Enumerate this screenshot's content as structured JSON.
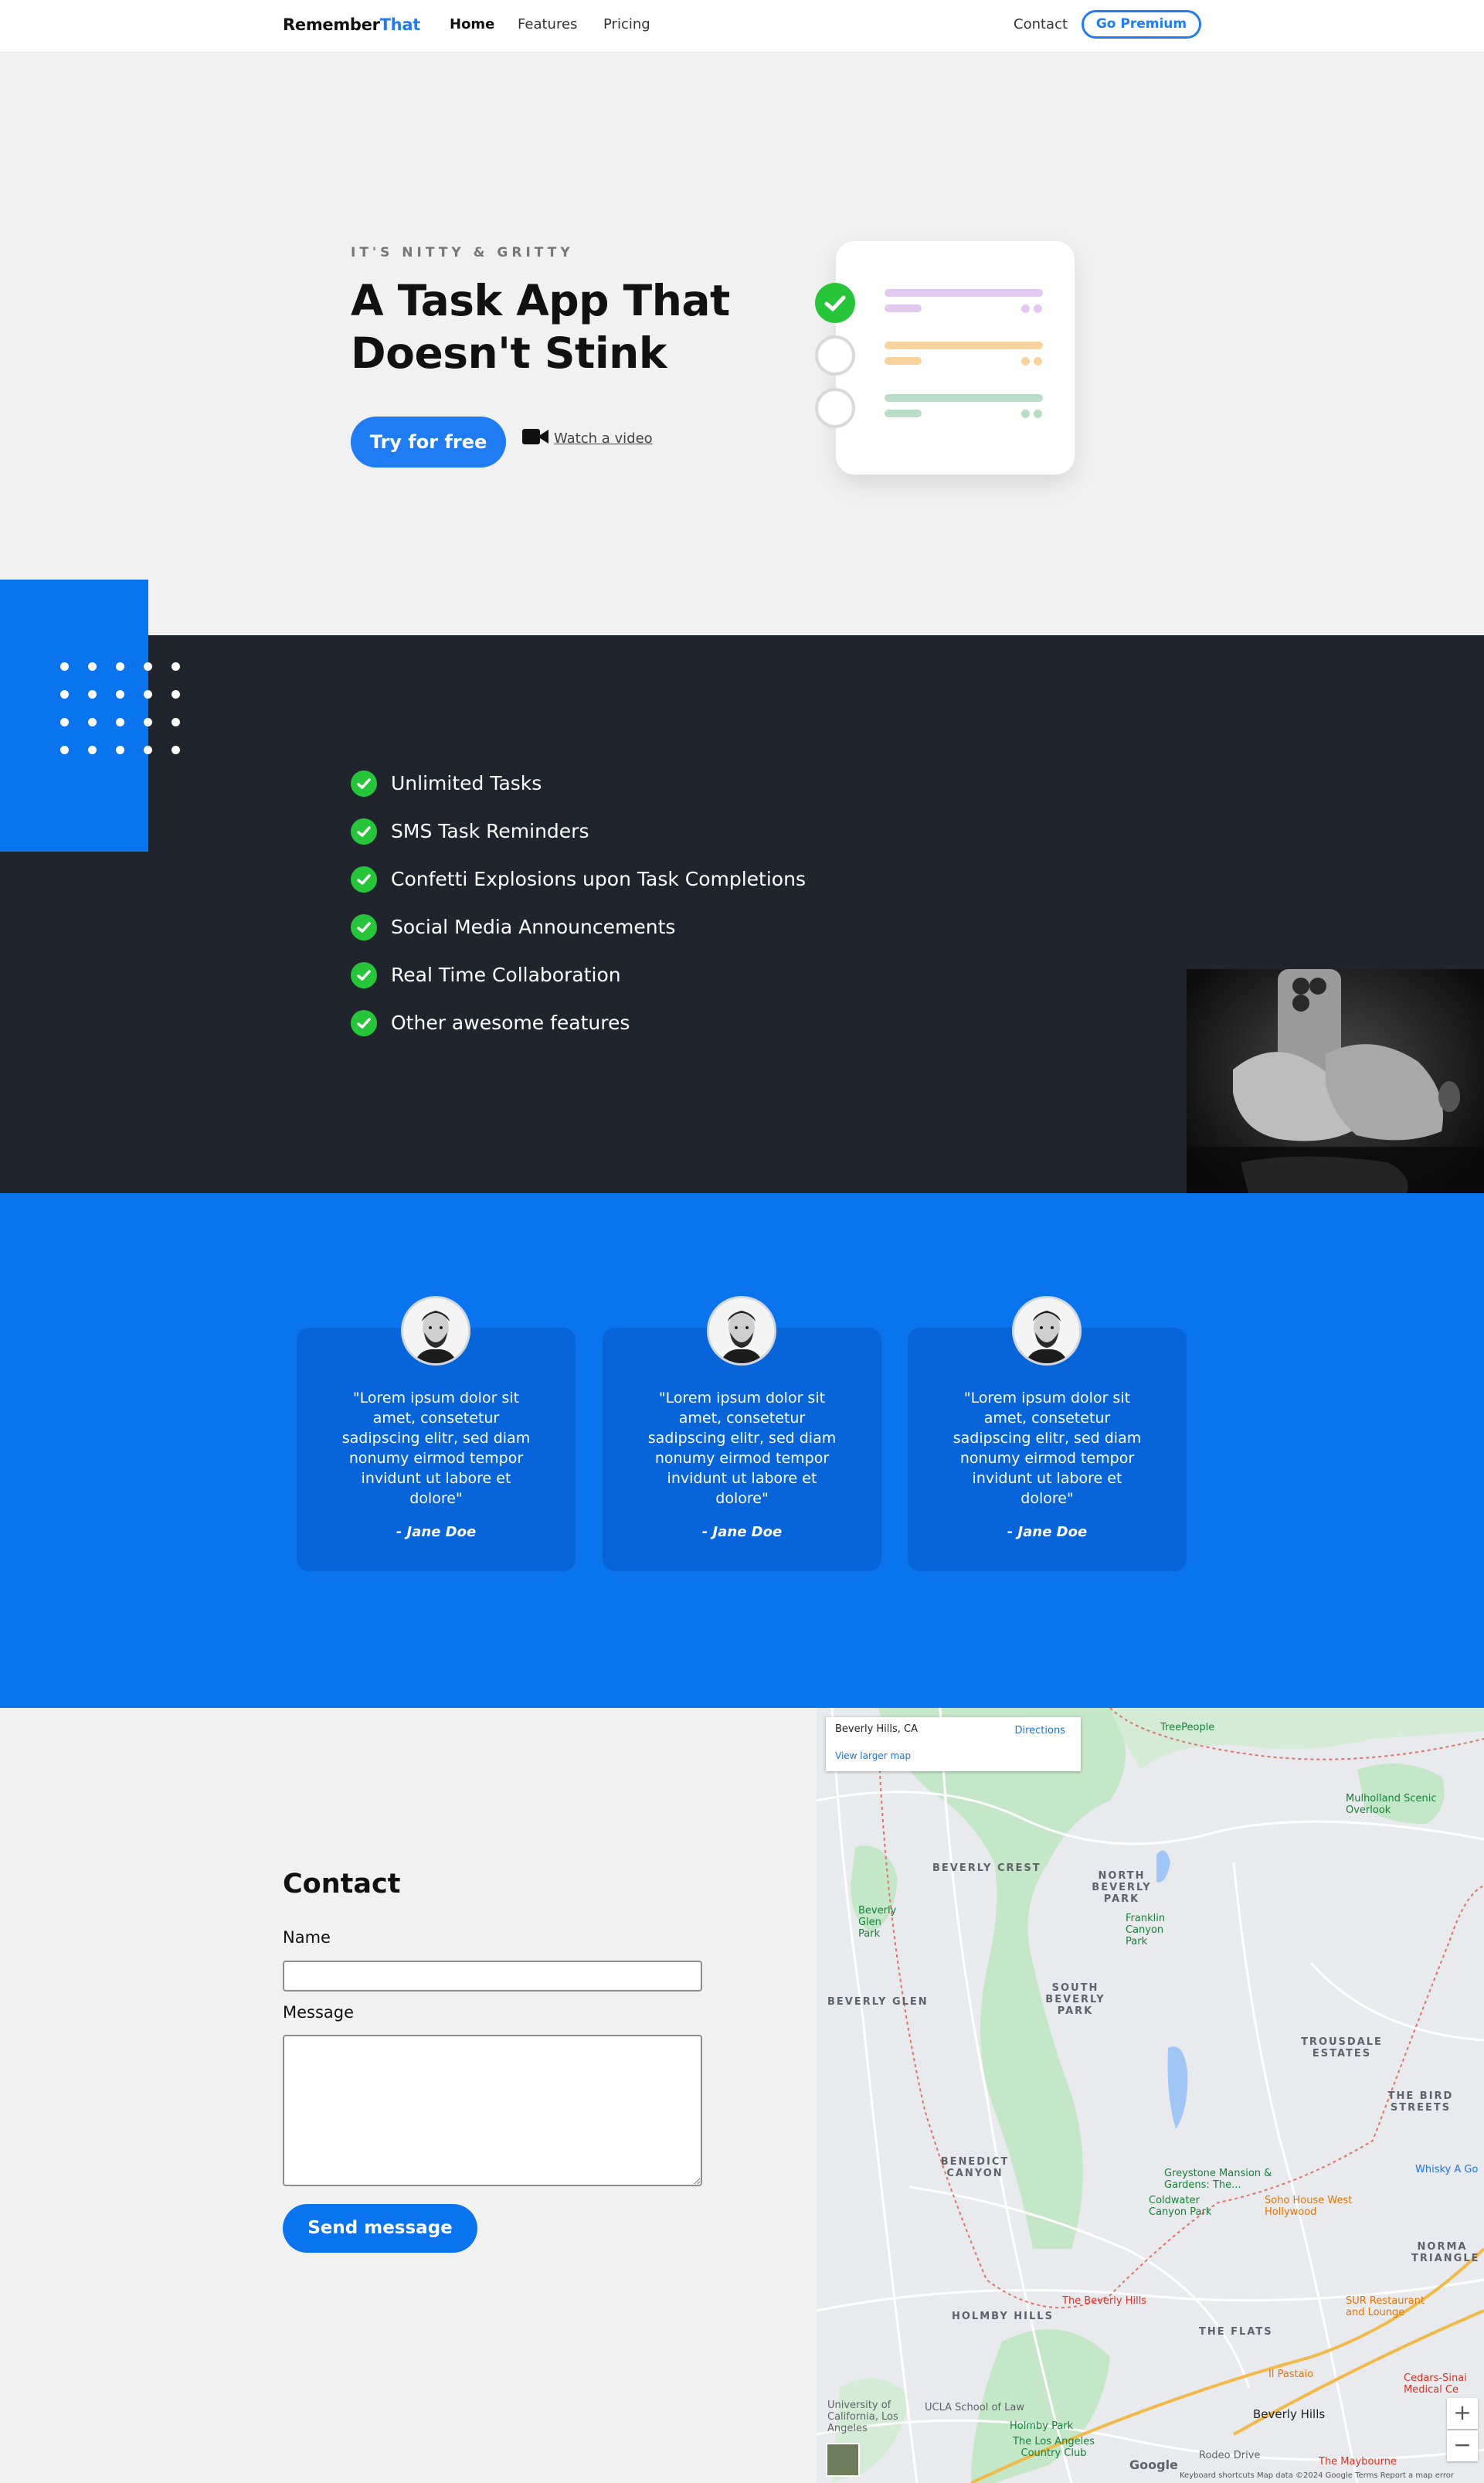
{
  "nav": {
    "brand_part1": "Remember",
    "brand_part2": "That",
    "links": [
      "Home",
      "Features",
      "Pricing"
    ],
    "contact": "Contact",
    "premium": "Go Premium"
  },
  "hero": {
    "eyebrow": "IT'S NITTY & GRITTY",
    "title": "A Task App That Doesn't Stink",
    "cta": "Try for free",
    "video_link": "Watch a video",
    "task_colors": [
      "#e3c8ef",
      "#f9d39c",
      "#b9ddc6"
    ],
    "task_states": [
      "done",
      "todo",
      "todo"
    ]
  },
  "features": {
    "items": [
      "Unlimited Tasks",
      "SMS Task Reminders",
      "Confetti Explosions upon Task Completions",
      "Social Media Announcements",
      "Real Time Collaboration",
      "Other awesome features"
    ]
  },
  "testimonials": [
    {
      "quote": "\"Lorem ipsum dolor sit amet, consetetur sadipscing elitr, sed diam nonumy eirmod tempor invidunt ut labore et dolore\"",
      "author": "- Jane Doe"
    },
    {
      "quote": "\"Lorem ipsum dolor sit amet, consetetur sadipscing elitr, sed diam nonumy eirmod tempor invidunt ut labore et dolore\"",
      "author": "- Jane Doe"
    },
    {
      "quote": "\"Lorem ipsum dolor sit amet, consetetur sadipscing elitr, sed diam nonumy eirmod tempor invidunt ut labore et dolore\"",
      "author": "- Jane Doe"
    }
  ],
  "contact": {
    "title": "Contact",
    "name_label": "Name",
    "message_label": "Message",
    "name_value": "",
    "message_value": "",
    "send": "Send message"
  },
  "map": {
    "place": "Beverly Hills, CA",
    "directions": "Directions",
    "view_larger": "View larger map",
    "areas": {
      "beverly_crest": "BEVERLY CREST",
      "north_beverly_park": "NORTH BEVERLY PARK",
      "south_beverly_park": "SOUTH BEVERLY PARK",
      "beverly_glen": "BEVERLY GLEN",
      "trousdale": "TROUSDALE ESTATES",
      "bird_streets": "THE BIRD STREETS",
      "benedict_canyon": "BENEDICT CANYON",
      "holmby_hills": "HOLMBY HILLS",
      "the_flats": "THE FLATS",
      "norma_triangle": "NORMA TRIANGLE"
    },
    "pois": {
      "treepeople": "TreePeople",
      "mulholland": "Mulholland Scenic Overlook",
      "franklin": "Franklin Canyon Park",
      "greystone": "Greystone Mansion & Gardens: The...",
      "coldwater": "Coldwater Canyon Park",
      "soho": "Soho House West Hollywood",
      "whisky": "Whisky A Go",
      "beverly_hills_hotel": "The Beverly Hills",
      "il_pastaio": "Il Pastaio",
      "sur": "SUR Restaurant and Lounge",
      "cedars": "Cedars-Sinai Medical Ce",
      "ucla_law": "UCLA School of Law",
      "ucla": "University of California, Los Angeles",
      "holmby_park": "Holmby Park",
      "la_country_club": "The Los Angeles Country Club",
      "beverly_hills": "Beverly Hills",
      "rodeo": "Rodeo Drive",
      "maybourne": "The Maybourne",
      "beverly_glen_park": "Beverly Glen Park"
    },
    "attribution": "Keyboard shortcuts   Map data ©2024 Google   Terms   Report a map error",
    "google": "Google",
    "zoom_in": "+",
    "zoom_out": "−"
  }
}
